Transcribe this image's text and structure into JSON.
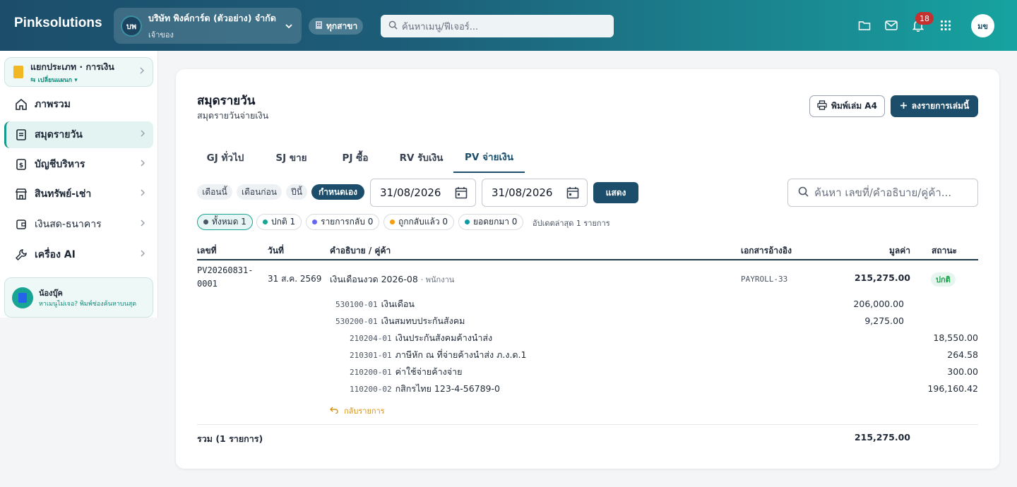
{
  "topbar": {
    "brand": "Pinksolutions",
    "company_initials": "บพ",
    "company_name": "บริษัท พิงค์การ์ด (ตัวอย่าง) จำกัด",
    "company_role": "เจ้าของ",
    "branch_label": "ทุกสาขา",
    "search_placeholder": "ค้นหาเมนู/ฟีเจอร์...",
    "notification_count": "18",
    "user_initials": "มข"
  },
  "sidebar": {
    "category_title": "แยกประเภท · การเงิน",
    "category_switch": "⇆ เปลี่ยนแผนก ▾",
    "items": [
      {
        "label": "ภาพรวม",
        "icon": "home-icon"
      },
      {
        "label": "สมุดรายวัน",
        "icon": "book-icon"
      },
      {
        "label": "บัญชีบริหาร",
        "icon": "money-doc-icon"
      },
      {
        "label": "สินทรัพย์-เช่า",
        "icon": "store-icon"
      },
      {
        "label": "เงินสด-ธนาคาร",
        "icon": "wallet-icon"
      },
      {
        "label": "เครื่อง AI",
        "icon": "wrench-icon"
      }
    ],
    "helper_title": "น้องบุ๊ค",
    "helper_text": "หาเมนูไม่เจอ? พิมพ์ช่องค้นหาบนสุด"
  },
  "page": {
    "title": "สมุดรายวัน",
    "subtitle": "สมุดรายวันจ่ายเงิน",
    "print_label": "พิมพ์เล่ม A4",
    "add_label": "ลงรายการเล่มนี้"
  },
  "tabs": [
    "GJ ทั่วไป",
    "SJ ขาย",
    "PJ ซื้อ",
    "RV รับเงิน",
    "PV จ่ายเงิน"
  ],
  "active_tab": "PV จ่ายเงิน",
  "period": {
    "chips": [
      "เดือนนี้",
      "เดือนก่อน",
      "ปีนี้",
      "กำหนดเอง"
    ],
    "active_chip": "กำหนดเอง",
    "date_from": "31/08/2026",
    "date_to": "31/08/2026",
    "show_label": "แสดง",
    "search_placeholder": "ค้นหา เลขที่/คำอธิบาย/คู่ค้า..."
  },
  "filters": [
    {
      "label": "ทั้งหมด 1",
      "color": "#4b5563"
    },
    {
      "label": "ปกติ 1",
      "color": "#19a594"
    },
    {
      "label": "รายการกลับ 0",
      "color": "#6366f1"
    },
    {
      "label": "ถูกกลับแล้ว 0",
      "color": "#f59e0b"
    },
    {
      "label": "ยอดยกมา 0",
      "color": "#0e9aa0"
    }
  ],
  "filter_note": "อัปเดตล่าสุด 1 รายการ",
  "table": {
    "columns": [
      "เลขที่",
      "วันที่",
      "คำอธิบาย / คู่ค้า",
      "เอกสารอ้างอิง",
      "มูลค่า",
      "สถานะ"
    ],
    "row": {
      "doc_no_1": "PV20260831-",
      "doc_no_2": "0001",
      "date": "31 ส.ค. 2569",
      "description": "เงินเดือนงวด 2026-08",
      "party": "· พนักงาน",
      "reference": "PAYROLL-33",
      "amount": "215,275.00",
      "status": "ปกติ"
    },
    "debit_lines": [
      {
        "code": "530100-01",
        "name": "เงินเดือน",
        "amount": "206,000.00"
      },
      {
        "code": "530200-01",
        "name": "เงินสมทบประกันสังคม",
        "amount": "9,275.00"
      }
    ],
    "credit_lines": [
      {
        "code": "210204-01",
        "name": "เงินประกันสังคมค้างนำส่ง",
        "amount": "18,550.00"
      },
      {
        "code": "210301-01",
        "name": "ภาษีหัก ณ ที่จ่ายค้างนำส่ง ภ.ง.ด.1",
        "amount": "264.58"
      },
      {
        "code": "210200-01",
        "name": "ค่าใช้จ่ายค้างจ่าย",
        "amount": "300.00"
      },
      {
        "code": "110200-02",
        "name": "กสิกรไทย 123-4-56789-0",
        "amount": "196,160.42"
      }
    ],
    "revert_label": "กลับรายการ",
    "total_label": "รวม (1 รายการ)",
    "total_amount": "215,275.00"
  }
}
